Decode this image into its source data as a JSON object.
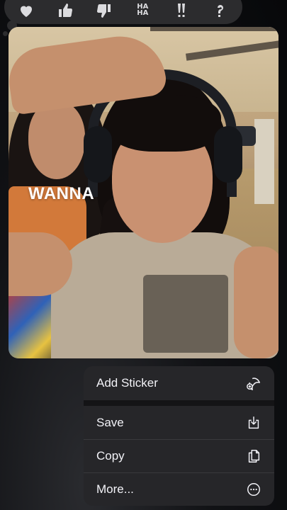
{
  "tapback": {
    "items": [
      {
        "icon": "heart-icon"
      },
      {
        "icon": "thumbs-up-icon"
      },
      {
        "icon": "thumbs-down-icon"
      },
      {
        "icon": "haha-icon",
        "text_top": "HA",
        "text_bottom": "HA"
      },
      {
        "icon": "double-exclamation-icon"
      },
      {
        "icon": "question-mark-icon"
      }
    ]
  },
  "photo": {
    "caption": "WANNA"
  },
  "menu": {
    "items": [
      {
        "label": "Add Sticker",
        "icon": "sticker-add-icon"
      },
      {
        "label": "Save",
        "icon": "save-download-icon"
      },
      {
        "label": "Copy",
        "icon": "copy-icon"
      },
      {
        "label": "More...",
        "icon": "more-ellipsis-icon"
      }
    ]
  },
  "colors": {
    "background": "#0b0c0e",
    "menu_bg": "#262629",
    "tapback_bg": "#2c2c2e",
    "text": "#f2f2f7"
  }
}
